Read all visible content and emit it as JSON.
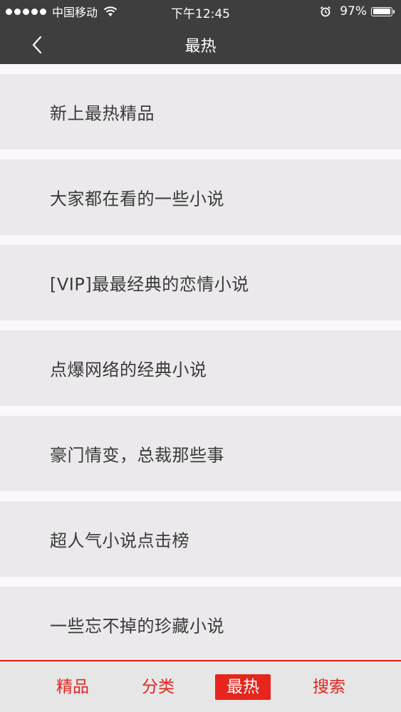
{
  "status_bar": {
    "carrier": "中国移动",
    "time": "下午12:45",
    "battery_percent": "97%",
    "battery_level": 0.97,
    "signal_icon": "signal-dots-icon",
    "wifi_icon": "wifi-icon",
    "alarm_icon": "alarm-clock-icon"
  },
  "nav": {
    "back_icon": "chevron-left-icon",
    "title": "最热"
  },
  "list": {
    "items": [
      {
        "label": "新上最热精品"
      },
      {
        "label": "大家都在看的一些小说"
      },
      {
        "label": "[VIP]最最经典的恋情小说"
      },
      {
        "label": "点爆网络的经典小说"
      },
      {
        "label": "豪门情变，总裁那些事"
      },
      {
        "label": "超人气小说点击榜"
      },
      {
        "label": "一些忘不掉的珍藏小说"
      }
    ]
  },
  "tab_bar": {
    "tabs": [
      {
        "label": "精品",
        "active": false
      },
      {
        "label": "分类",
        "active": false
      },
      {
        "label": "最热",
        "active": true
      },
      {
        "label": "搜索",
        "active": false
      }
    ]
  },
  "colors": {
    "header_bg": "#3f3e3f",
    "accent": "#e6251c",
    "item_bg": "#ebe9eb",
    "page_bg": "#fbf8fb"
  }
}
